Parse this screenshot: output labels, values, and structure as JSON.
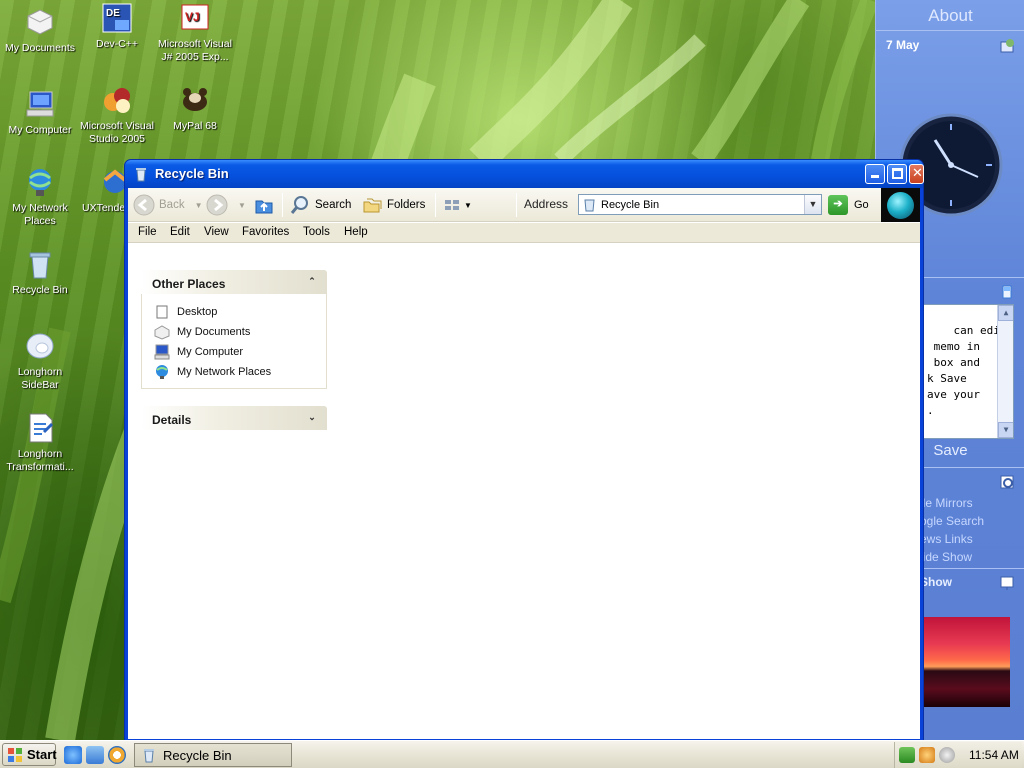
{
  "desktop": {
    "icons": [
      {
        "label": "My Documents"
      },
      {
        "label": "Dev-C++"
      },
      {
        "label": "Microsoft Visual J# 2005 Exp..."
      },
      {
        "label": "My Computer"
      },
      {
        "label": "Microsoft Visual Studio 2005"
      },
      {
        "label": "MyPal 68"
      },
      {
        "label": "My Network Places"
      },
      {
        "label": "UXTende"
      },
      {
        "label": "Recycle Bin"
      },
      {
        "label": "Longhorn SideBar"
      },
      {
        "label": "Longhorn Transformati..."
      }
    ]
  },
  "sidebar": {
    "about": "About",
    "date": "7 May",
    "notes_text": "can edit\n memo in\n box and\nk Save\nave your\n.",
    "save_label": "Save",
    "links": [
      "ile Mirrors",
      "ogle Search",
      "ews Links",
      "lide Show"
    ],
    "slideshow_title": "Show"
  },
  "window": {
    "title": "Recycle Bin",
    "toolbar": {
      "back_label": "Back",
      "search_label": "Search",
      "folders_label": "Folders",
      "address_label": "Address",
      "address_value": "Recycle Bin",
      "go_label": "Go"
    },
    "menu": [
      "File",
      "Edit",
      "View",
      "Favorites",
      "Tools",
      "Help"
    ],
    "other_places": {
      "title": "Other Places",
      "items": [
        "Desktop",
        "My Documents",
        "My Computer",
        "My Network Places"
      ]
    },
    "details": {
      "title": "Details"
    }
  },
  "taskbar": {
    "start_label": "Start",
    "task_label": "Recycle Bin",
    "clock": "11:54 AM"
  },
  "colors": {
    "title_bar": "#0550dc",
    "sidebar": "#5e84d8",
    "taskbar": "#e8e5d6"
  }
}
